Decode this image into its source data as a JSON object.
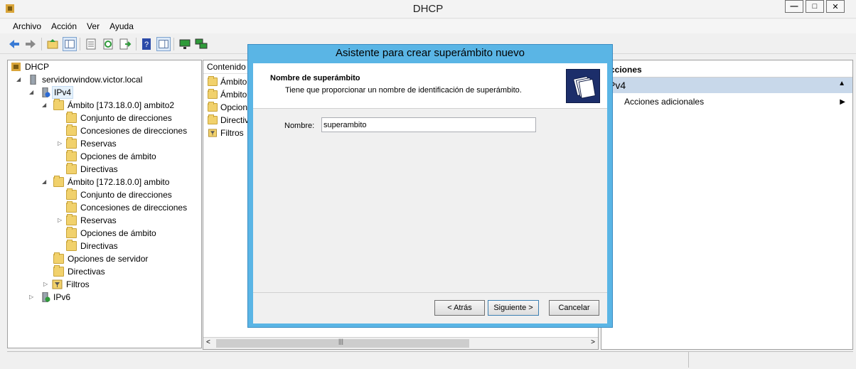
{
  "window": {
    "title": "DHCP",
    "min_icon": "minimize-icon",
    "max_icon": "maximize-icon",
    "close_icon": "close-icon"
  },
  "menu": [
    "Archivo",
    "Acción",
    "Ver",
    "Ayuda"
  ],
  "toolbar_icons": [
    "back-arrow-icon",
    "forward-arrow-icon",
    "up-folder-icon",
    "show-tree-icon",
    "properties-icon",
    "refresh-icon",
    "export-icon",
    "help-icon",
    "show-action-pane-icon",
    "monitor-icon",
    "network-icon"
  ],
  "tree": {
    "items": [
      {
        "label": "DHCP"
      },
      {
        "label": "servidorwindow.victor.local"
      },
      {
        "label": "IPv4"
      },
      {
        "label": "Ámbito [173.18.0.0] ambito2"
      },
      {
        "label": "Conjunto de direcciones"
      },
      {
        "label": "Concesiones de direcciones"
      },
      {
        "label": "Reservas"
      },
      {
        "label": "Opciones de ámbito"
      },
      {
        "label": "Directivas"
      },
      {
        "label": "Ámbito [172.18.0.0] ambito"
      },
      {
        "label": "Conjunto de direcciones"
      },
      {
        "label": "Concesiones de direcciones"
      },
      {
        "label": "Reservas"
      },
      {
        "label": "Opciones de ámbito"
      },
      {
        "label": "Directivas"
      },
      {
        "label": "Opciones de servidor"
      },
      {
        "label": "Directivas"
      },
      {
        "label": "Filtros"
      },
      {
        "label": "IPv6"
      }
    ]
  },
  "content": {
    "header": "Contenido",
    "rows": [
      "Ámbito",
      "Ámbito",
      "Opcion",
      "Directiv",
      "Filtros"
    ]
  },
  "actions": {
    "header": "cciones",
    "group": "Pv4",
    "item": "Acciones adicionales"
  },
  "dialog": {
    "title": "Asistente para crear superámbito nuevo",
    "heading": "Nombre de superámbito",
    "subheading": "Tiene que proporcionar un nombre de identificación de superámbito.",
    "field_label": "Nombre:",
    "field_value": "superambito",
    "back_label": "< Atrás",
    "next_label": "Siguiente >",
    "cancel_label": "Cancelar"
  }
}
